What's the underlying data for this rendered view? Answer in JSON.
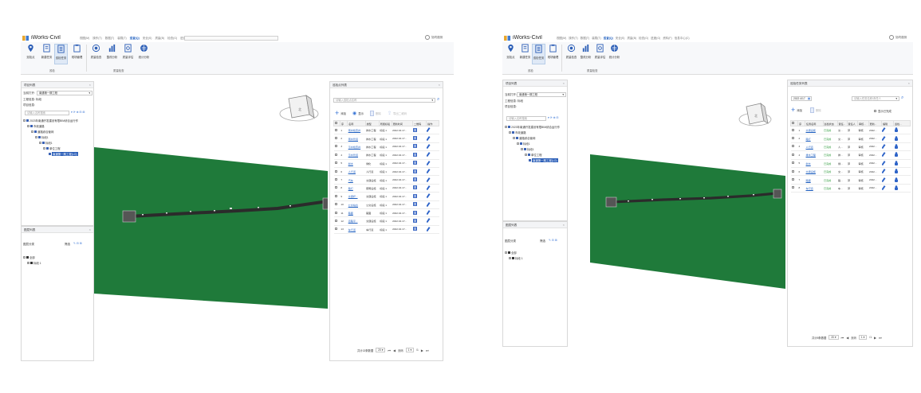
{
  "app": {
    "title": "iWorks-Civil",
    "menus": [
      "视图(M)",
      "操作(T)",
      "数据(T)",
      "装载(T)",
      "巡查(Q)",
      "安全(S)",
      "质量(B)",
      "检查(G)",
      "进度(G)",
      "资料(F)",
      "信息中心(C)"
    ],
    "active_menu": "巡查(Q)",
    "user_label": "协同观测"
  },
  "ribbon": {
    "buttons": [
      "巡检点",
      "新建任务",
      "巡检任务",
      "现场管理",
      "质量检查",
      "整改分析",
      "质量评估",
      "统计分析"
    ],
    "selected_left": "巡检任务",
    "selected_right": "巡检任务",
    "groups": [
      "巡检",
      "质量检查"
    ]
  },
  "left_panel": {
    "title": "项目列表",
    "project_label": "当前打开:",
    "project_value": "南通第一期工程",
    "sub1": "工程信息: 标段",
    "sub2": "项目信息:",
    "search_placeholder": "请输入名称搜索",
    "tree": [
      "2023年南通开发建设有限BIM综合运行作",
      "市政道路",
      "道路综合管网",
      "标段1",
      "标段1",
      "单位工程",
      "南通第一期工程(LO)"
    ]
  },
  "bottom_left_panel": {
    "title": "图层列表",
    "label": "图层分类",
    "filter_label": "筛选",
    "tree": [
      "全部",
      "标段 1"
    ]
  },
  "right_panel_left": {
    "title": "巡检点列表",
    "search_placeholder": "请输入巡检点名称",
    "buttons": {
      "add": "添加",
      "show": "显示",
      "delete": "删除",
      "export": "导出二维码"
    },
    "columns": [
      "序",
      "名称",
      "类型",
      "所属标段",
      "更新时间",
      "二维码",
      "操作"
    ],
    "rows": [
      {
        "no": "1",
        "name": "雨水检查井",
        "type": "排水工程",
        "section": "标段 1",
        "time": "2022.04.17..."
      },
      {
        "no": "2",
        "name": "雨水管道",
        "type": "排水工程",
        "section": "标段 1",
        "time": "2022.04.17..."
      },
      {
        "no": "3",
        "name": "污水检查井",
        "type": "排水工程",
        "section": "标段 1",
        "time": "2022.04.17..."
      },
      {
        "no": "4",
        "name": "污水管道",
        "type": "排水工程",
        "section": "标段 1",
        "time": "2022.04.17..."
      },
      {
        "no": "5",
        "name": "树木",
        "type": "绿化",
        "section": "标段 1",
        "time": "2022.04.17..."
      },
      {
        "no": "6",
        "name": "人行道",
        "type": "人行道",
        "section": "标段 1",
        "time": "2022.04.17..."
      },
      {
        "no": "7",
        "name": "汽车",
        "type": "交通设施",
        "section": "标段 1",
        "time": "2022.04.17..."
      },
      {
        "no": "8",
        "name": "路灯",
        "type": "照明设施",
        "section": "标段 1",
        "time": "2022.04.17..."
      },
      {
        "no": "9",
        "name": "交通杆...",
        "type": "交通设施",
        "section": "标段 1",
        "time": "2022.04.17..."
      },
      {
        "no": "10",
        "name": "公交站台",
        "type": "公交设施",
        "section": "标段 1",
        "time": "2022.04.17..."
      },
      {
        "no": "11",
        "name": "路面",
        "type": "路面",
        "section": "标段 1",
        "time": "2022.04.17..."
      },
      {
        "no": "12",
        "name": "道路平...",
        "type": "交通设施",
        "section": "标段 1",
        "time": "2022.04.17..."
      },
      {
        "no": "13",
        "name": "车行道",
        "type": "车行道",
        "section": "标段 1",
        "time": "2022.04.17..."
      }
    ],
    "pager": {
      "total": "共计13条数据",
      "size": "20",
      "page_label": "页码",
      "page": "1",
      "of": "/1"
    }
  },
  "right_panel_right": {
    "title": "巡检任务列表",
    "date": "2022 4/17",
    "search_placeholder": "请输入任务名称/责任人",
    "buttons": {
      "add": "添加",
      "delete": "删除"
    },
    "checkbox_label": "显示已完成",
    "columns": [
      "序",
      "任务名称",
      "巡检状态",
      "责任...",
      "责任人",
      "审核...",
      "更新...",
      "编辑",
      "巡检..."
    ],
    "rows": [
      {
        "no": "1",
        "name": "交通设施",
        "status": "已完成",
        "c4": "交...",
        "c5": "郭",
        "c6": "审核",
        "c7": "2022..."
      },
      {
        "no": "2",
        "name": "路灯",
        "status": "已完成",
        "c4": "交...",
        "c5": "郭",
        "c6": "审核",
        "c7": "2022..."
      },
      {
        "no": "3",
        "name": "人行道",
        "status": "已完成",
        "c4": "人...",
        "c5": "郭",
        "c6": "审核",
        "c7": "2022..."
      },
      {
        "no": "4",
        "name": "排水工程",
        "status": "已完成",
        "c4": "排...",
        "c5": "郭",
        "c6": "审核",
        "c7": "2022..."
      },
      {
        "no": "5",
        "name": "树木",
        "status": "已完成",
        "c4": "绿...",
        "c5": "郭",
        "c6": "审核",
        "c7": "2022..."
      },
      {
        "no": "6",
        "name": "交通设施",
        "status": "已完成",
        "c4": "交...",
        "c5": "郭",
        "c6": "审核",
        "c7": "2022..."
      },
      {
        "no": "7",
        "name": "路面",
        "status": "已完成",
        "c4": "路...",
        "c5": "郭",
        "c6": "审核",
        "c7": "2022..."
      },
      {
        "no": "8",
        "name": "车行道",
        "status": "已完成",
        "c4": "车...",
        "c5": "郭",
        "c6": "审核",
        "c7": "2022..."
      }
    ],
    "pager": {
      "total": "共计8条数据",
      "size": "20",
      "page_label": "页码",
      "page": "1",
      "of": "/1"
    }
  },
  "scene": {
    "ground_color": "#1f7a3a",
    "road_color": "#2b2b2b",
    "compass_label": "北"
  }
}
